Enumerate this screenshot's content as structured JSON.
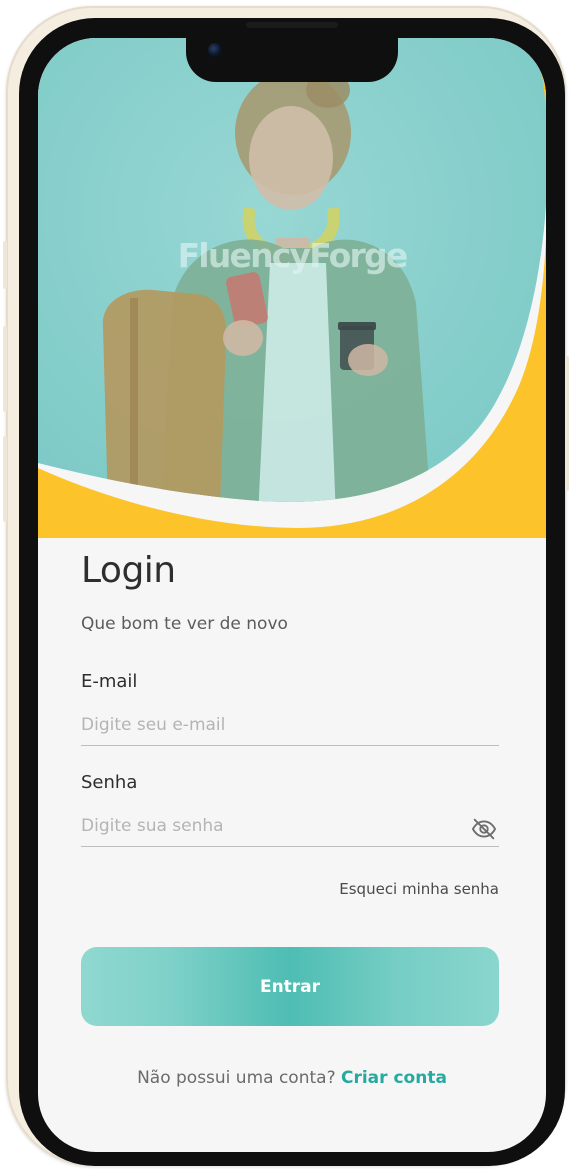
{
  "brand": {
    "name": "FluencyForge"
  },
  "login": {
    "title": "Login",
    "subtitle": "Que bom te ver de novo",
    "email_label": "E-mail",
    "email_placeholder": "Digite seu e-mail",
    "email_value": "",
    "password_label": "Senha",
    "password_placeholder": "Digite sua senha",
    "password_value": "",
    "password_toggle_icon": "eye-off-icon",
    "forgot_password": "Esqueci minha senha",
    "submit_label": "Entrar",
    "signup_prompt": "Não possui uma conta?",
    "signup_link": "Criar conta"
  },
  "colors": {
    "accent_teal": "#4ebdb3",
    "hero_yellow": "#fcc32a",
    "link_teal": "#24aaa0",
    "background": "#f6f6f6"
  }
}
